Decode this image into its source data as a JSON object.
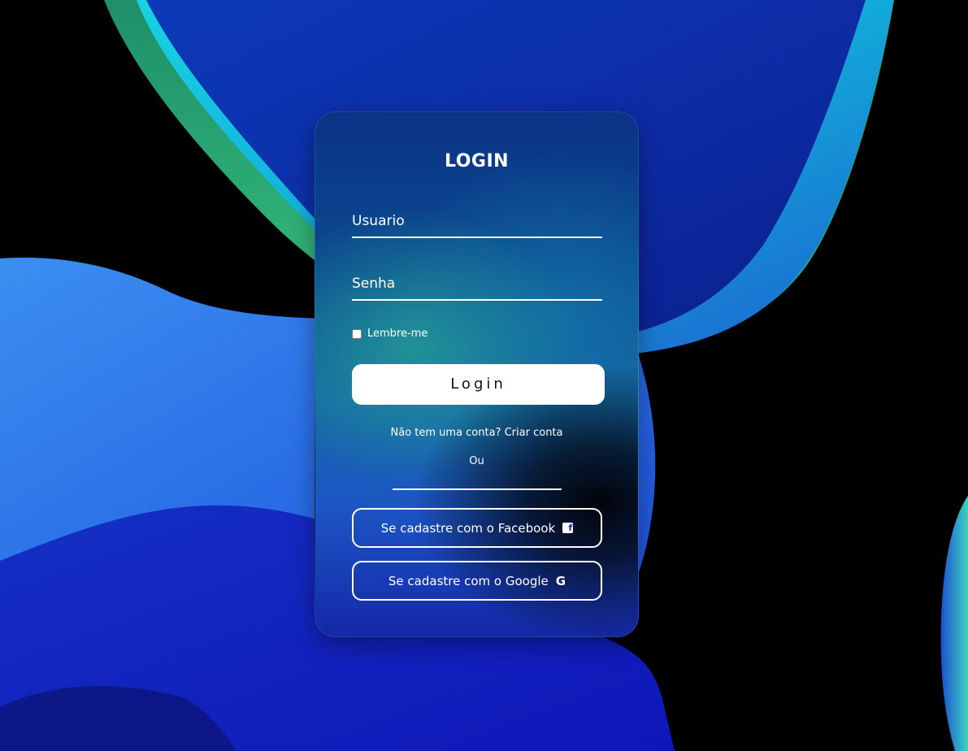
{
  "login_card": {
    "title": "LOGIN",
    "username_placeholder": "Usuario",
    "password_placeholder": "Senha",
    "remember_label": "Lembre-me",
    "login_button": "Login",
    "no_account_text": "Não tem uma conta?",
    "create_account_link": "Criar conta",
    "or_text": "Ou",
    "facebook_button": "Se cadastre com o Facebook",
    "google_button": "Se cadastre com o Google"
  },
  "icons": {
    "facebook": "facebook-icon",
    "google": "google-icon"
  },
  "colors": {
    "page_background": "#000000",
    "card_top": "#0b3387",
    "card_bottom": "#1428a8",
    "accent_teal": "#19d6e6",
    "accent_green": "#2fb86a",
    "text": "#ffffff",
    "button_bg": "#ffffff",
    "button_text": "#111111"
  }
}
